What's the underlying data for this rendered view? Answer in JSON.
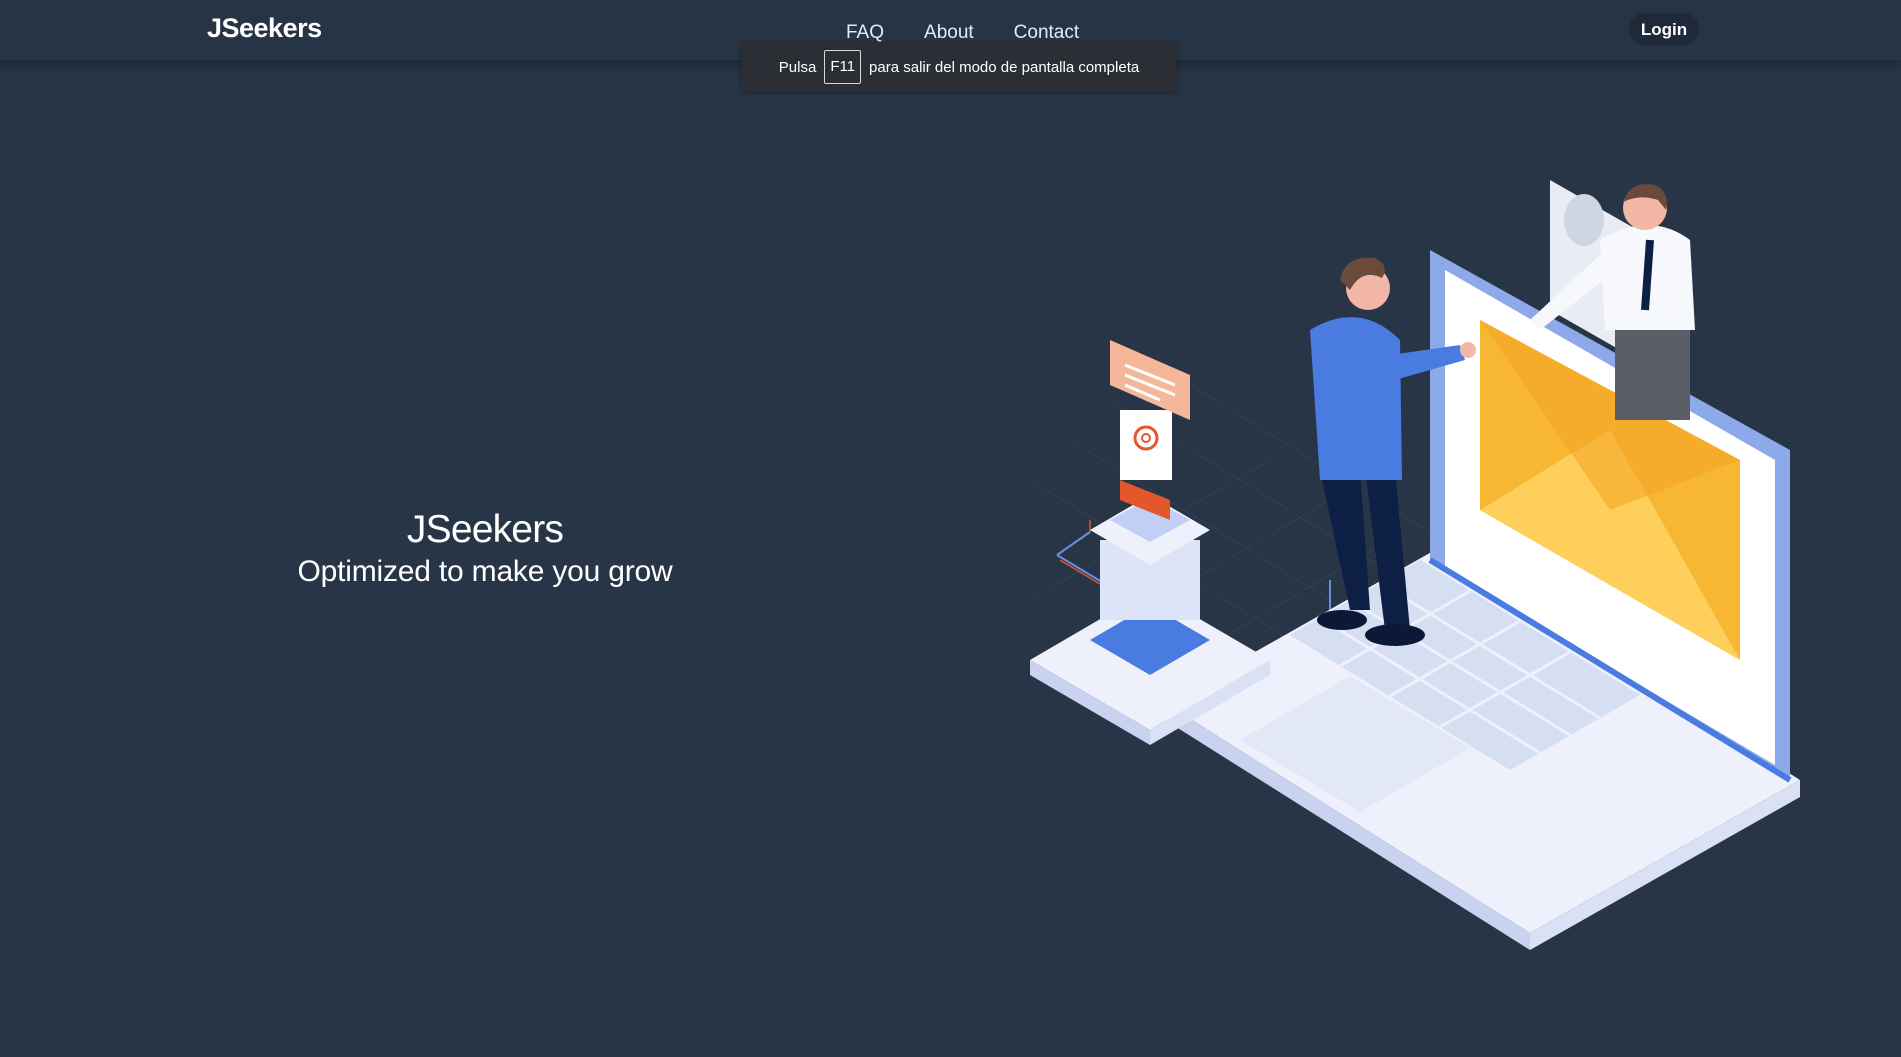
{
  "navbar": {
    "brand": "JSeekers",
    "links": [
      "FAQ",
      "About",
      "Contact"
    ],
    "login_label": "Login"
  },
  "fullscreen_notice": {
    "prefix": "Pulsa",
    "key": "F11",
    "suffix": "para salir del modo de pantalla completa"
  },
  "hero": {
    "title": "JSeekers",
    "subtitle": "Optimized to make you grow"
  },
  "colors": {
    "background": "#283546",
    "accent_blue": "#4a7be0",
    "envelope_yellow": "#f7b733",
    "email_orange": "#e2572b"
  },
  "icons": {
    "illustration": "handshake-laptop-illustration"
  }
}
